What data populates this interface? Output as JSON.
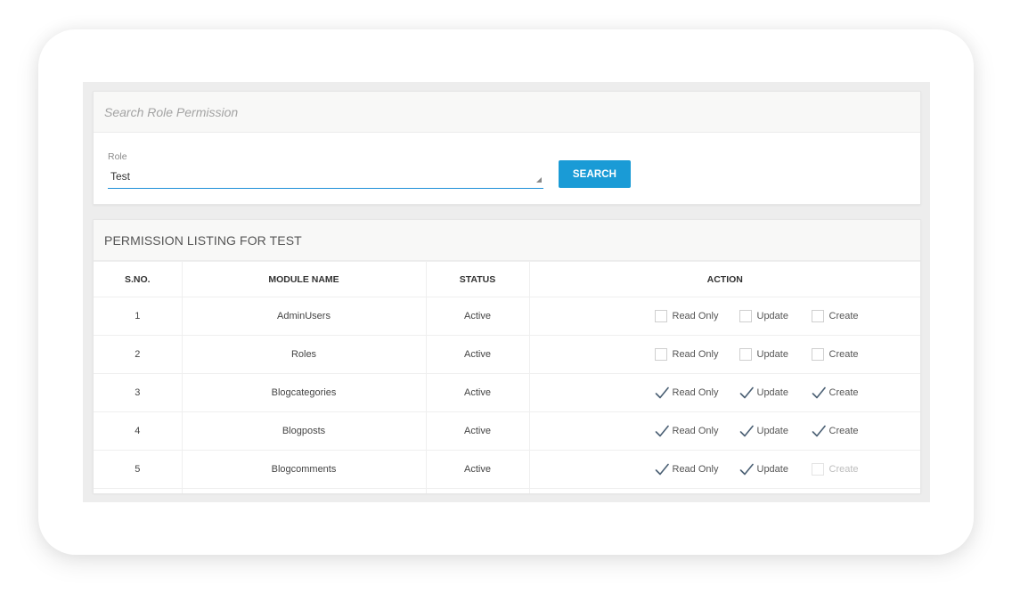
{
  "search_panel": {
    "title": "Search Role Permission",
    "role_label": "Role",
    "role_value": "Test",
    "search_button": "SEARCH"
  },
  "listing": {
    "title": "PERMISSION LISTING FOR TEST",
    "columns": [
      "S.NO.",
      "MODULE NAME",
      "STATUS",
      "ACTION"
    ],
    "permission_labels": [
      "Read Only",
      "Update",
      "Create"
    ],
    "rows": [
      {
        "sno": "1",
        "module": "AdminUsers",
        "status": "Active",
        "read": false,
        "update": false,
        "create": false,
        "create_disabled": false
      },
      {
        "sno": "2",
        "module": "Roles",
        "status": "Active",
        "read": false,
        "update": false,
        "create": false,
        "create_disabled": false
      },
      {
        "sno": "3",
        "module": "Blogcategories",
        "status": "Active",
        "read": true,
        "update": true,
        "create": true,
        "create_disabled": false
      },
      {
        "sno": "4",
        "module": "Blogposts",
        "status": "Active",
        "read": true,
        "update": true,
        "create": true,
        "create_disabled": false
      },
      {
        "sno": "5",
        "module": "Blogcomments",
        "status": "Active",
        "read": true,
        "update": true,
        "create": false,
        "create_disabled": true
      }
    ]
  },
  "colors": {
    "accent": "#1a9bd6",
    "input_underline": "#1e8fd8",
    "check": "#4a5f73"
  }
}
